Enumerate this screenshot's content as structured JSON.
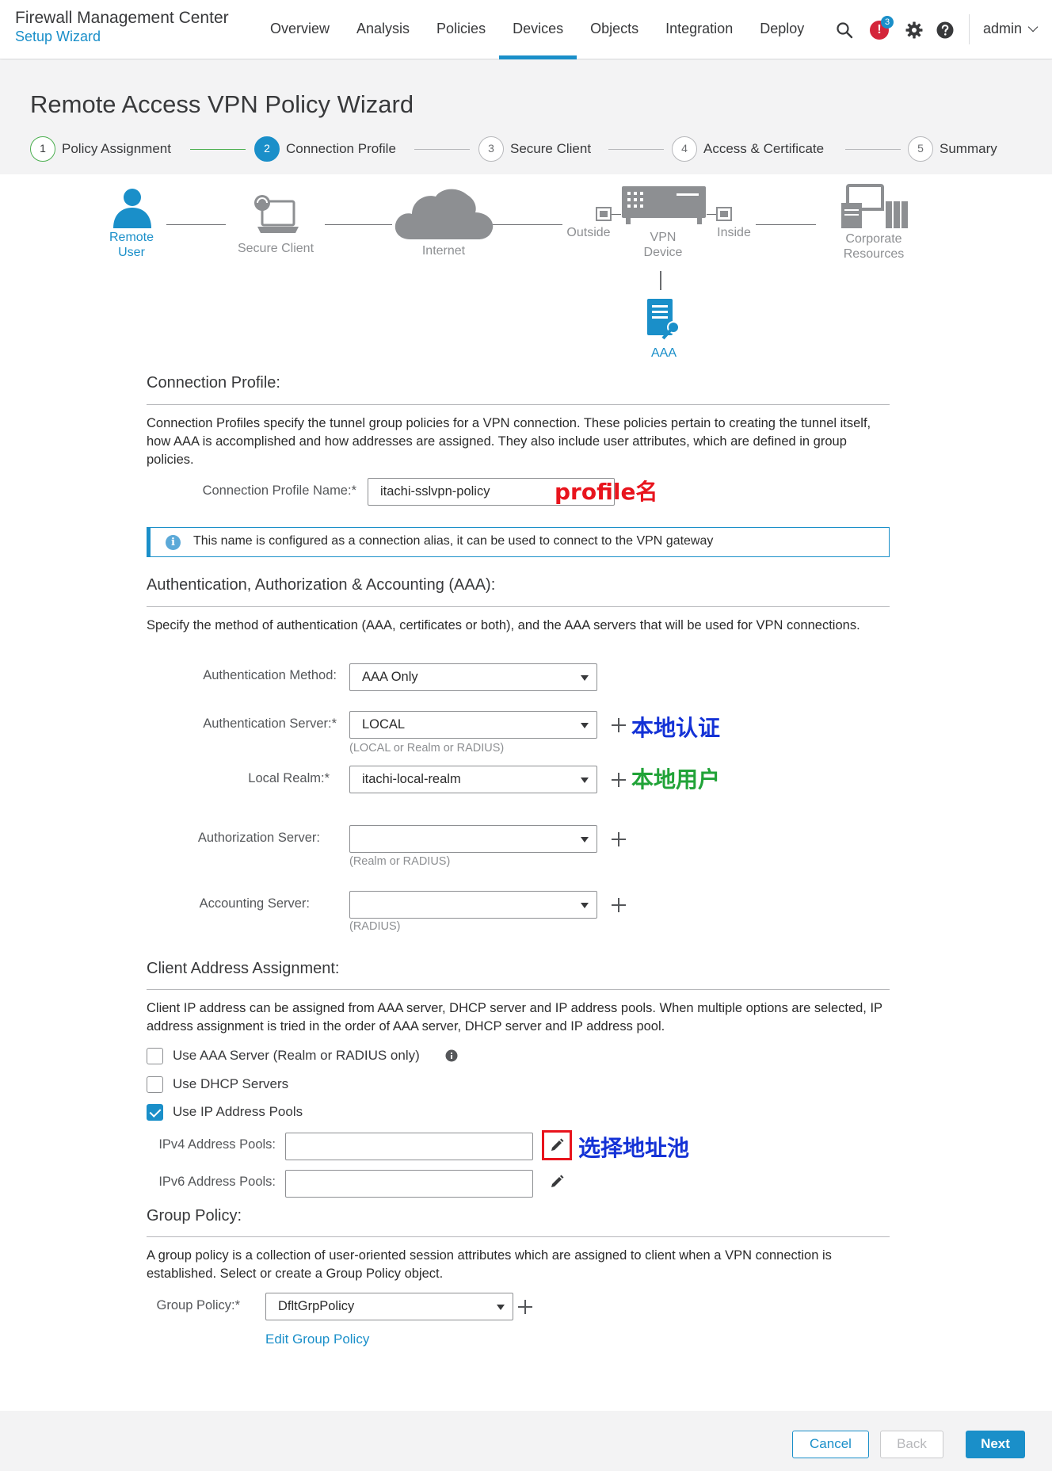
{
  "app": {
    "title": "Firewall Management Center",
    "subtitle": "Setup Wizard"
  },
  "nav": {
    "items": [
      {
        "label": "Overview"
      },
      {
        "label": "Analysis"
      },
      {
        "label": "Policies"
      },
      {
        "label": "Devices",
        "active": true
      },
      {
        "label": "Objects"
      },
      {
        "label": "Integration"
      },
      {
        "label": "Deploy"
      }
    ],
    "alert_badge_count": "3",
    "alert_symbol": "!",
    "user": "admin",
    "icons": [
      "search-icon",
      "alert-icon",
      "gear-icon",
      "help-icon",
      "chevron-down-icon"
    ]
  },
  "page": {
    "title": "Remote Access VPN Policy Wizard"
  },
  "steps": [
    {
      "num": "1",
      "label": "Policy Assignment",
      "state": "done"
    },
    {
      "num": "2",
      "label": "Connection Profile",
      "state": "current"
    },
    {
      "num": "3",
      "label": "Secure Client",
      "state": "pending"
    },
    {
      "num": "4",
      "label": "Access & Certificate",
      "state": "pending"
    },
    {
      "num": "5",
      "label": "Summary",
      "state": "pending"
    }
  ],
  "diagram": {
    "remote_user": "Remote User",
    "remote_user_l1": "Remote",
    "remote_user_l2": "User",
    "secure_client": "Secure Client",
    "internet": "Internet",
    "outside": "Outside",
    "vpn_device_l1": "VPN",
    "vpn_device_l2": "Device",
    "inside": "Inside",
    "corporate_l1": "Corporate",
    "corporate_l2": "Resources",
    "aaa": "AAA"
  },
  "connection_profile": {
    "heading": "Connection Profile:",
    "description": "Connection Profiles specify the tunnel group policies for a VPN connection. These policies pertain to creating the tunnel itself, how AAA is accomplished and how addresses are assigned. They also include user attributes, which are defined in group policies.",
    "name_label": "Connection Profile Name:*",
    "name_value": "itachi-sslvpn-policy",
    "annotation": "profile名",
    "info_text": "This name is configured as a connection alias, it can be used to connect to the VPN gateway",
    "info_icon": "i"
  },
  "aaa": {
    "heading": "Authentication, Authorization & Accounting (AAA):",
    "description": "Specify the method of authentication (AAA, certificates or both), and the AAA servers that will be used for VPN connections.",
    "auth_method_label": "Authentication Method:",
    "auth_method_value": "AAA Only",
    "auth_server_label": "Authentication Server:*",
    "auth_server_value": "LOCAL",
    "auth_server_hint": "(LOCAL or Realm or RADIUS)",
    "auth_server_annotation": "本地认证",
    "local_realm_label": "Local Realm:*",
    "local_realm_value": "itachi-local-realm",
    "local_realm_annotation": "本地用户",
    "authz_server_label": "Authorization Server:",
    "authz_server_value": "",
    "authz_server_hint": "(Realm or RADIUS)",
    "acct_server_label": "Accounting Server:",
    "acct_server_value": "",
    "acct_server_hint": "(RADIUS)"
  },
  "client_address": {
    "heading": "Client Address Assignment:",
    "description": "Client IP address can be assigned from AAA server, DHCP server and IP address pools. When multiple options are selected, IP address assignment is tried in the order of AAA server, DHCP server and IP address pool.",
    "use_aaa_label": "Use AAA Server (Realm or RADIUS only)",
    "use_aaa_checked": false,
    "use_dhcp_label": "Use DHCP Servers",
    "use_dhcp_checked": false,
    "use_pools_label": "Use IP Address Pools",
    "use_pools_checked": true,
    "ipv4_label": "IPv4 Address Pools:",
    "ipv4_value": "",
    "ipv4_annotation": "选择地址池",
    "ipv6_label": "IPv6 Address Pools:",
    "ipv6_value": ""
  },
  "group_policy": {
    "heading": "Group Policy:",
    "description": "A group policy is a collection of user-oriented session attributes which are assigned to client when a VPN connection is established. Select or create a Group Policy object.",
    "label": "Group Policy:*",
    "value": "DfltGrpPolicy",
    "edit_link": "Edit Group Policy"
  },
  "footer": {
    "cancel": "Cancel",
    "back": "Back",
    "next": "Next"
  },
  "colors": {
    "accent": "#1a8fc9",
    "step_done": "#4caf50",
    "annotation_red": "#e8141d",
    "annotation_blue": "#1432d6",
    "annotation_green": "#21a338",
    "highlight_box": "#e8141d"
  }
}
